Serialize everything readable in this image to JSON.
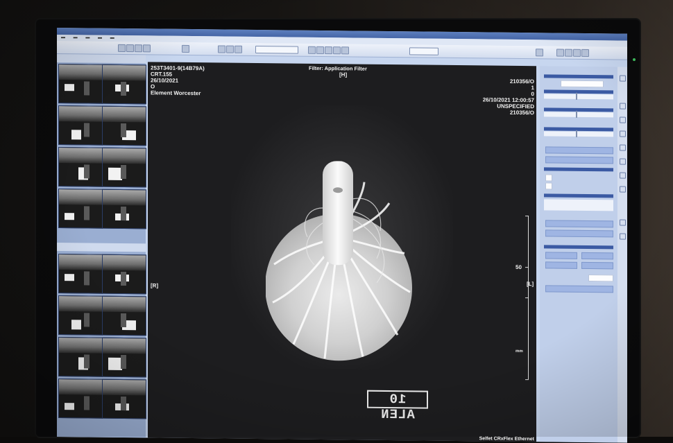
{
  "viewer": {
    "top_left": [
      "253T3401-9(14B79A)",
      "CRT.155",
      "26/10/2021",
      "O",
      "Element Worcester"
    ],
    "filter_label": "Filter: Application Filter",
    "orientation_top": "[H]",
    "orientation_left": "[R]",
    "orientation_right": "[L]",
    "top_right": [
      "210356/O",
      "1",
      "0",
      "26/10/2021 12:00:57",
      "UNSPECIFIED",
      "210356/O"
    ],
    "scale_value": "50",
    "scale_unit": "mm",
    "footer_device": "Selfet CRxFlex Ethernet",
    "stamp_text": "10 ALEN"
  },
  "colors": {
    "ui_accent": "#3b5aa3",
    "panel_bg": "#c0cfea",
    "viewer_bg": "#1d1d1f"
  },
  "icons": [
    "shield-icon",
    "zoom-icon",
    "rotate-icon",
    "window-level-icon",
    "cursor-icon"
  ]
}
